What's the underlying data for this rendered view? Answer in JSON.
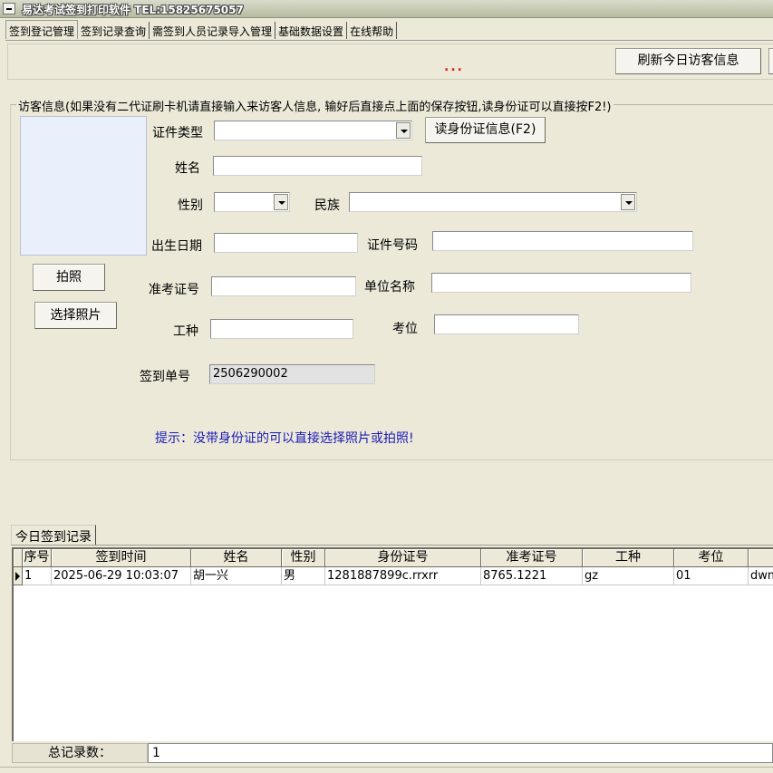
{
  "window": {
    "title": "易达考试签到打印软件 TEL:15825675057"
  },
  "tabs": [
    {
      "label": "签到登记管理",
      "active": true
    },
    {
      "label": "签到记录查询"
    },
    {
      "label": "需签到人员记录导入管理"
    },
    {
      "label": "基础数据设置"
    },
    {
      "label": "在线帮助"
    }
  ],
  "toolbar": {
    "refresh_button": "刷新今日访客信息",
    "indicator": "..."
  },
  "visitor": {
    "legend": "访客信息(如果没有二代证刷卡机请直接输入来访客人信息, 输好后直接点上面的保存按钮,读身份证可以直接按F2!)",
    "take_photo_button": "拍照",
    "choose_photo_button": "选择照片",
    "read_id_button": "读身份证信息(F2)",
    "labels": {
      "id_type": "证件类型",
      "name": "姓名",
      "gender": "性别",
      "ethnicity": "民族",
      "birth_date": "出生日期",
      "id_number": "证件号码",
      "admission_no": "准考证号",
      "unit_name": "单位名称",
      "job_type": "工种",
      "seat": "考位",
      "checkin_no": "签到单号"
    },
    "values": {
      "id_type": "",
      "name": "",
      "gender": "",
      "ethnicity": "",
      "birth_date": "",
      "id_number": "",
      "admission_no": "",
      "unit_name": "",
      "job_type": "",
      "seat": "",
      "checkin_no": "2506290002"
    },
    "tip": "提示：没带身份证的可以直接选择照片或拍照!"
  },
  "records": {
    "tab_label": "今日签到记录",
    "columns": [
      "序号",
      "签到时间",
      "姓名",
      "性别",
      "身份证号",
      "准考证号",
      "工种",
      "考位",
      ""
    ],
    "rows": [
      [
        "1",
        "2025-06-29 10:03:07",
        "胡一兴",
        "男",
        "1281887899c.rrxrr",
        "8765.1221",
        "gz",
        "01",
        "dwm"
      ]
    ],
    "total_label": "总记录数：",
    "total_value": "1"
  },
  "colors": {
    "window_bg": "#ece9d8",
    "photo_bg": "#eaf0fb",
    "tip_text": "#1a1ab8",
    "dots": "#e31b1b"
  }
}
